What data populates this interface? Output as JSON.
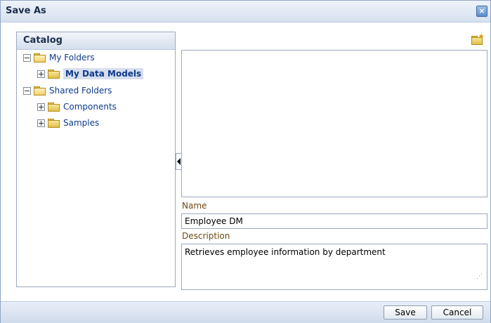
{
  "dialog": {
    "title": "Save As"
  },
  "catalog": {
    "title": "Catalog",
    "tree": [
      {
        "label": "My Folders",
        "expanded": true
      },
      {
        "label": "My Data Models",
        "expanded": false,
        "selected": true
      },
      {
        "label": "Shared Folders",
        "expanded": true
      },
      {
        "label": "Components",
        "expanded": false
      },
      {
        "label": "Samples",
        "expanded": false
      }
    ]
  },
  "form": {
    "name_label": "Name",
    "name_value": "Employee DM",
    "description_label": "Description",
    "description_value": "Retrieves employee information by department"
  },
  "footer": {
    "save_label": "Save",
    "cancel_label": "Cancel"
  },
  "icons": {
    "close": "close-icon",
    "new_folder": "new-folder-icon",
    "folder": "folder-icon"
  },
  "colors": {
    "link": "#0e3a8a",
    "field_label": "#6b4b12",
    "border": "#9aa9bd"
  }
}
